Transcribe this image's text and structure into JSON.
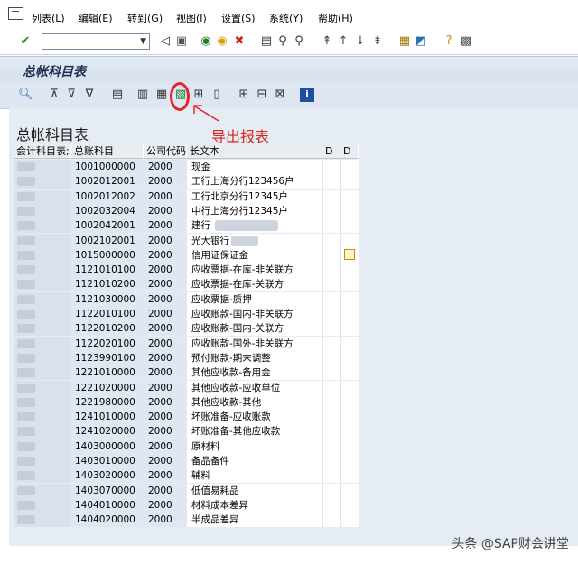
{
  "menu": {
    "items": [
      "列表(L)",
      "编辑(E)",
      "转到(G)",
      "视图(I)",
      "设置(S)",
      "系统(Y)",
      "帮助(H)"
    ]
  },
  "toolbar": {
    "command_field_value": ""
  },
  "title": "总帐科目表",
  "list_title": "总帐科目表",
  "table": {
    "headers": [
      "会计科目表;;",
      "总账科目",
      "公司代码",
      "长文本",
      "D",
      "D"
    ],
    "rows": [
      [
        "1001000000",
        "2000",
        "现金"
      ],
      [
        "1002012001",
        "2000",
        "工行上海分行123456户"
      ],
      [
        "1002012002",
        "2000",
        "工行北京分行12345户"
      ],
      [
        "1002032004",
        "2000",
        "中行上海分行12345户"
      ],
      [
        "1002042001",
        "2000",
        "建行"
      ],
      [
        "1002102001",
        "2000",
        "光大银行"
      ],
      [
        "1015000000",
        "2000",
        "信用证保证金"
      ],
      [
        "1121010100",
        "2000",
        "应收票据-在库-非关联方"
      ],
      [
        "1121010200",
        "2000",
        "应收票据-在库-关联方"
      ],
      [
        "1121030000",
        "2000",
        "应收票据-质押"
      ],
      [
        "1122010100",
        "2000",
        "应收账款-国内-非关联方"
      ],
      [
        "1122010200",
        "2000",
        "应收账款-国内-关联方"
      ],
      [
        "1122020100",
        "2000",
        "应收账款-国外-非关联方"
      ],
      [
        "1123990100",
        "2000",
        "预付账款-期末调整"
      ],
      [
        "1221010000",
        "2000",
        "其他应收款-备用金"
      ],
      [
        "1221020000",
        "2000",
        "其他应收款-应收单位"
      ],
      [
        "1221980000",
        "2000",
        "其他应收款-其他"
      ],
      [
        "1241010000",
        "2000",
        "坏账准备-应收账款"
      ],
      [
        "1241020000",
        "2000",
        "坏账准备-其他应收款"
      ],
      [
        "1403000000",
        "2000",
        "原材料"
      ],
      [
        "1403010000",
        "2000",
        "备品备件"
      ],
      [
        "1403020000",
        "2000",
        "辅料"
      ],
      [
        "1403070000",
        "2000",
        "低值易耗品"
      ],
      [
        "1404010000",
        "2000",
        "材料成本差异"
      ],
      [
        "1404020000",
        "2000",
        "半成品差异"
      ]
    ]
  },
  "annotation": {
    "text": "导出报表",
    "color": "#d9251d"
  },
  "watermark": "头条 @SAP财会讲堂"
}
